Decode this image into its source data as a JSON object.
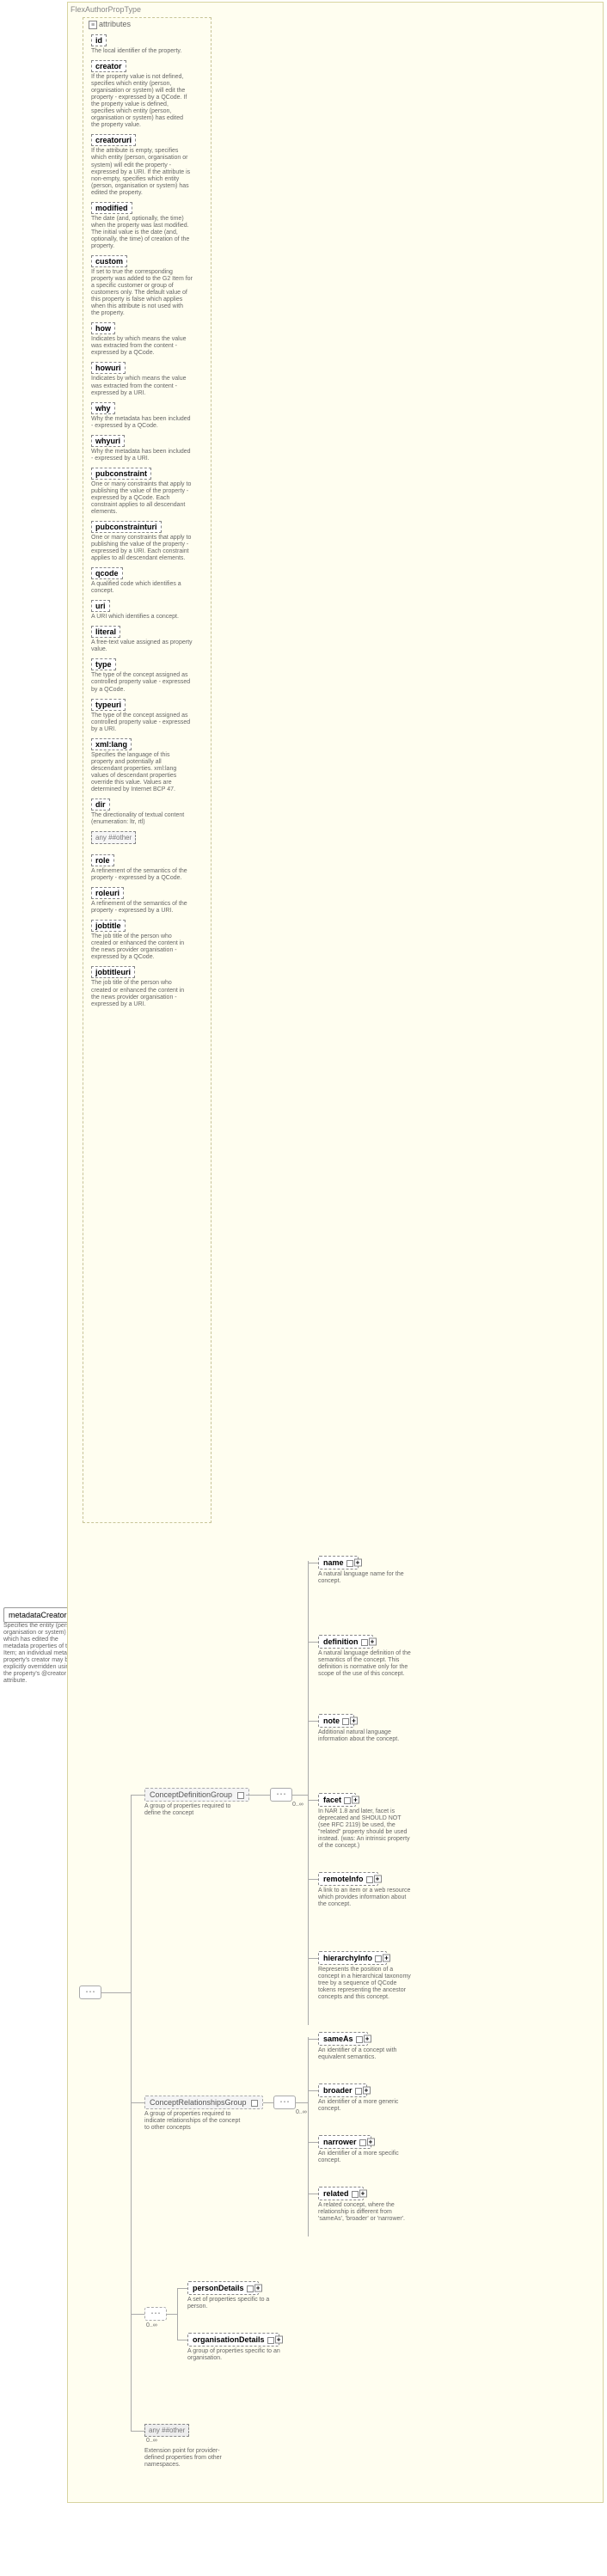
{
  "typeTitle": "FlexAuthorPropType",
  "root": {
    "label": "metadataCreator",
    "desc": "Specifies the entity (person, organisation or system) which has edited the metadata properties of this Item; an individual metadata property's creator may be explicitly overridden using the property's @creator attribute."
  },
  "attrHeader": "attributes",
  "attributes": [
    {
      "name": "id",
      "desc": "The local identifier of the property."
    },
    {
      "name": "creator",
      "desc": "If the property value is not defined, specifies which entity (person, organisation or system) will edit the property - expressed by a QCode. If the property value is defined, specifies which entity (person, organisation or system) has edited the property value."
    },
    {
      "name": "creatoruri",
      "desc": "If the attribute is empty, specifies which entity (person, organisation or system) will edit the property - expressed by a URI. If the attribute is non-empty, specifies which entity (person, organisation or system) has edited the property."
    },
    {
      "name": "modified",
      "desc": "The date (and, optionally, the time) when the property was last modified. The initial value is the date (and, optionally, the time) of creation of the property."
    },
    {
      "name": "custom",
      "desc": "If set to true the corresponding property was added to the G2 Item for a specific customer or group of customers only. The default value of this property is false which applies when this attribute is not used with the property."
    },
    {
      "name": "how",
      "desc": "Indicates by which means the value was extracted from the content - expressed by a QCode."
    },
    {
      "name": "howuri",
      "desc": "Indicates by which means the value was extracted from the content - expressed by a URI."
    },
    {
      "name": "why",
      "desc": "Why the metadata has been included - expressed by a QCode."
    },
    {
      "name": "whyuri",
      "desc": "Why the metadata has been included - expressed by a URI."
    },
    {
      "name": "pubconstraint",
      "desc": "One or many constraints that apply to publishing the value of the property - expressed by a QCode. Each constraint applies to all descendant elements."
    },
    {
      "name": "pubconstrainturi",
      "desc": "One or many constraints that apply to publishing the value of the property - expressed by a URI. Each constraint applies to all descendant elements."
    },
    {
      "name": "qcode",
      "desc": "A qualified code which identifies a concept."
    },
    {
      "name": "uri",
      "desc": "A URI which identifies a concept."
    },
    {
      "name": "literal",
      "desc": "A free-text value assigned as property value."
    },
    {
      "name": "type",
      "desc": "The type of the concept assigned as controlled property value - expressed by a QCode."
    },
    {
      "name": "typeuri",
      "desc": "The type of the concept assigned as controlled property value - expressed by a URI."
    },
    {
      "name": "xml:lang",
      "desc": "Specifies the language of this property and potentially all descendant properties. xml:lang values of descendant properties override this value. Values are determined by Internet BCP 47."
    },
    {
      "name": "dir",
      "desc": "The directionality of textual content (enumeration: ltr, rtl)"
    }
  ],
  "anyOtherAttr": "any ##other",
  "attrExtra": [
    {
      "name": "role",
      "desc": "A refinement of the semantics of the property - expressed by a QCode."
    },
    {
      "name": "roleuri",
      "desc": "A refinement of the semantics of the property - expressed by a URI."
    },
    {
      "name": "jobtitle",
      "desc": "The job title of the person who created or enhanced the content in the news provider organisation - expressed by a QCode."
    },
    {
      "name": "jobtitleuri",
      "desc": "The job title of the person who created or enhanced the content in the news provider organisation - expressed by a URI."
    }
  ],
  "groups": {
    "def": {
      "label": "ConceptDefinitionGroup",
      "desc": "A group of properties required to define the concept"
    },
    "rel": {
      "label": "ConceptRelationshipsGroup",
      "desc": "A group of properties required to indicate relationships of the concept to other concepts"
    }
  },
  "occ": "0..∞",
  "defChildren": [
    {
      "name": "name",
      "desc": "A natural language name for the concept."
    },
    {
      "name": "definition",
      "desc": "A natural language definition of the semantics of the concept. This definition is normative only for the scope of the use of this concept."
    },
    {
      "name": "note",
      "desc": "Additional natural language information about the concept."
    },
    {
      "name": "facet",
      "desc": "In NAR 1.8 and later, facet is deprecated and SHOULD NOT (see RFC 2119) be used, the \"related\" property should be used instead. (was: An intrinsic property of the concept.)"
    },
    {
      "name": "remoteInfo",
      "desc": "A link to an item or a web resource which provides information about the concept."
    },
    {
      "name": "hierarchyInfo",
      "desc": "Represents the position of a concept in a hierarchical taxonomy tree by a sequence of QCode tokens representing the ancestor concepts and this concept."
    }
  ],
  "relChildren": [
    {
      "name": "sameAs",
      "desc": "An identifier of a concept with equivalent semantics."
    },
    {
      "name": "broader",
      "desc": "An identifier of a more generic concept."
    },
    {
      "name": "narrower",
      "desc": "An identifier of a more specific concept."
    },
    {
      "name": "related",
      "desc": "A related concept, where the relationship is different from 'sameAs', 'broader' or 'narrower'."
    }
  ],
  "choiceChildren": [
    {
      "name": "personDetails",
      "desc": "A set of properties specific to a person."
    },
    {
      "name": "organisationDetails",
      "desc": "A group of properties specific to an organisation."
    }
  ],
  "anyOther": {
    "label": "any ##other",
    "desc": "Extension point for provider-defined properties from other namespaces."
  }
}
